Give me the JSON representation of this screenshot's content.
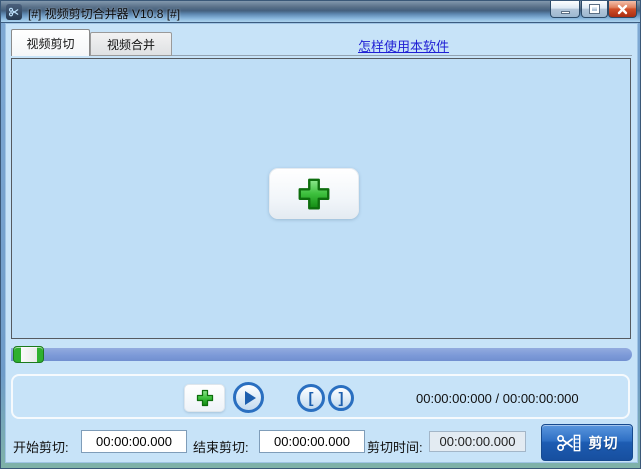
{
  "window": {
    "title": "[#] 视频剪切合并器 V10.8 [#]"
  },
  "tabs": [
    {
      "label": "视频剪切",
      "active": true
    },
    {
      "label": "视频合并",
      "active": false
    }
  ],
  "help_link": {
    "label": "怎样使用本软件"
  },
  "player": {
    "time_display": "00:00:00:000 / 00:00:00:000",
    "slider_position_percent": 0
  },
  "cut_form": {
    "start_label": "开始剪切:",
    "start_value": "00:00:00.000",
    "end_label": "结束剪切:",
    "end_value": "00:00:00.000",
    "duration_label": "剪切时间:",
    "duration_value": "00:00:00.000",
    "cut_button_label": "剪切"
  },
  "icons": {
    "title": "scissors-icon",
    "add": "green-plus-icon",
    "play": "play-icon",
    "set_start": "bracket-open-icon",
    "set_end": "bracket-close-icon",
    "cut": "scissors-film-icon"
  },
  "colors": {
    "client_background": "#c7e3f8",
    "panel_background": "#bfdef6",
    "slider_track": "#7d9ad8",
    "handle_green": "#2fb02f",
    "link_blue": "#1f1fd4",
    "control_ring_blue": "#2a6fc0",
    "cut_button_blue": "#2e6fc4",
    "close_button_red": "#d14f28"
  }
}
